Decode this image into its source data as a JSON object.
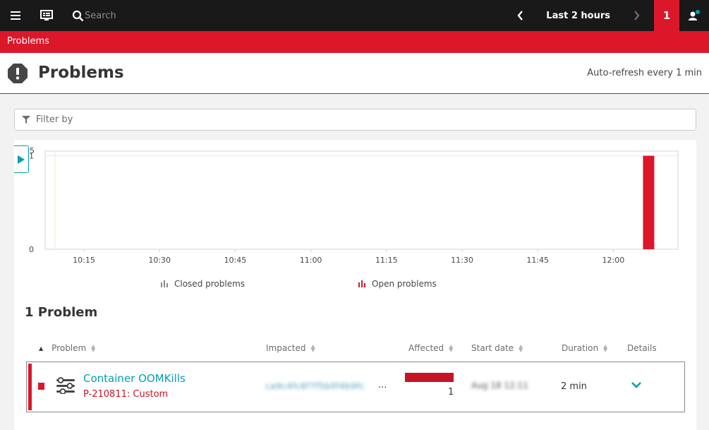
{
  "topbar": {
    "search_placeholder": "Search",
    "timeframe_label": "Last 2 hours",
    "problem_badge": "1"
  },
  "breadcrumb": {
    "label": "Problems"
  },
  "header": {
    "title": "Problems",
    "refresh_text": "Auto-refresh every 1 min"
  },
  "filter": {
    "placeholder": "Filter by"
  },
  "chart_data": {
    "type": "bar",
    "ylim": [
      0,
      1.05
    ],
    "y_ticks": [
      "0",
      "1",
      "1.05"
    ],
    "x_ticks": [
      "10:15",
      "10:30",
      "10:45",
      "11:00",
      "11:15",
      "11:30",
      "11:45",
      "12:00"
    ],
    "series": [
      {
        "name": "Closed problems",
        "color": "#898989",
        "points": []
      },
      {
        "name": "Open problems",
        "color": "#dc172a",
        "points": [
          {
            "x": "12:07",
            "y": 1
          }
        ]
      }
    ]
  },
  "problems_section": {
    "count_title": "1 Problem",
    "columns": {
      "problem": "Problem",
      "impacted": "Impacted",
      "affected": "Affected",
      "start_date": "Start date",
      "duration": "Duration",
      "details": "Details"
    },
    "rows": [
      {
        "name": "Container OOMKills",
        "id": "P-210811: Custom",
        "impacted": "ca9c4fc6f7f5b0f4b9fc",
        "impacted_more": "...",
        "affected": "1",
        "affected_fraction": 1,
        "start_date": "Aug 18 12:11",
        "duration": "2 min"
      }
    ]
  },
  "colors": {
    "brand_red": "#dc172a",
    "link_teal": "#00a1b2",
    "topbar_bg": "#191919"
  }
}
